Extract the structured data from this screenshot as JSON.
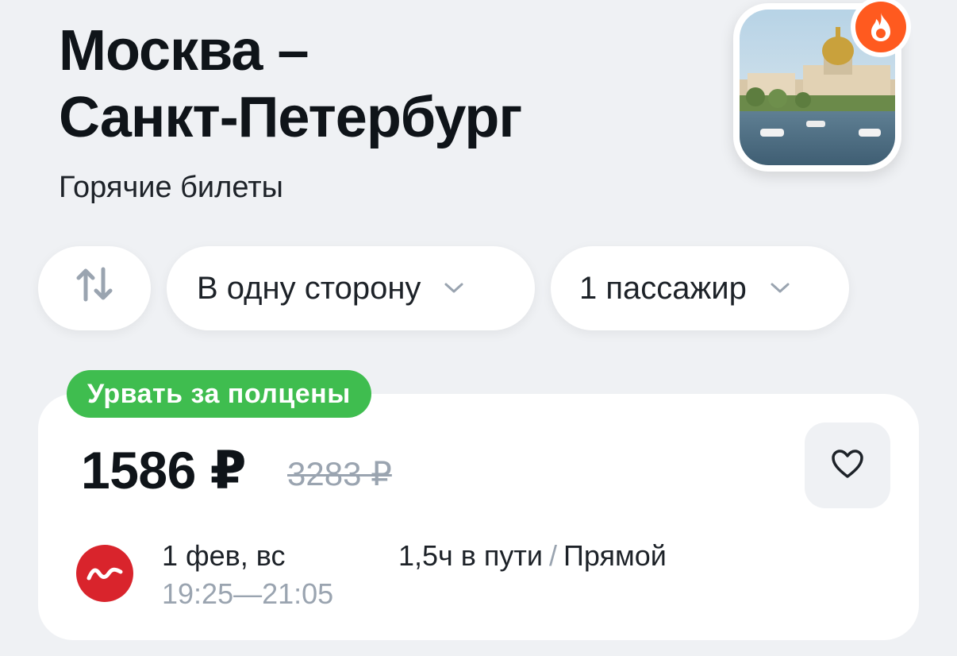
{
  "header": {
    "title_line1": "Москва –",
    "title_line2": "Санкт-Петербург",
    "subtitle": "Горячие билеты",
    "thumbnail_icon": "city-photo",
    "badge_icon": "fire-icon"
  },
  "filters": {
    "swap_icon": "swap-arrows-icon",
    "direction_label": "В одну сторону",
    "passengers_label": "1 пассажир"
  },
  "offer": {
    "badge": "Урвать за полцены",
    "price": "1586 ₽",
    "old_price": "3283 ₽",
    "favorite_icon": "heart-icon",
    "carrier_icon": "airline-logo-icon",
    "date": "1 фев, вс",
    "time_depart": "19:25",
    "time_dash": "—",
    "time_arrive": "21:05",
    "duration": "1,5ч в пути",
    "separator": "/",
    "stops": "Прямой"
  },
  "colors": {
    "background": "#eff1f4",
    "badge_green": "#3fbd4f",
    "fire_orange": "#ff5a1f",
    "carrier_red": "#d9242c",
    "muted_text": "#9aa4b0"
  }
}
